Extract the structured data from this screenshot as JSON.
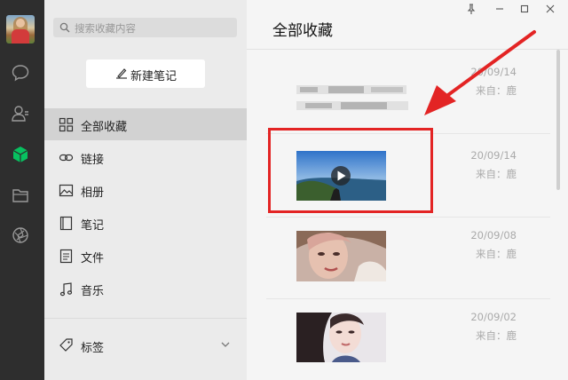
{
  "sidebar_rail": {
    "icons": [
      "avatar",
      "chat-icon",
      "contacts-icon",
      "favorites-cube-icon",
      "folder-icon",
      "moments-icon"
    ]
  },
  "search": {
    "placeholder": "搜索收藏内容"
  },
  "new_note": {
    "label": "新建笔记"
  },
  "nav": [
    {
      "label": "全部收藏",
      "icon": "grid-icon",
      "active": true
    },
    {
      "label": "链接",
      "icon": "link-icon"
    },
    {
      "label": "相册",
      "icon": "photo-icon"
    },
    {
      "label": "笔记",
      "icon": "note-icon"
    },
    {
      "label": "文件",
      "icon": "file-icon"
    },
    {
      "label": "音乐",
      "icon": "music-icon"
    }
  ],
  "tags": {
    "label": "标签"
  },
  "main": {
    "title": "全部收藏",
    "items": [
      {
        "date": "20/09/14",
        "source": "来自：鹿",
        "kind": "text-blurred"
      },
      {
        "date": "20/09/14",
        "source": "来自：鹿",
        "kind": "video"
      },
      {
        "date": "20/09/08",
        "source": "来自：鹿",
        "kind": "image"
      },
      {
        "date": "20/09/02",
        "source": "来自：鹿",
        "kind": "image"
      }
    ]
  },
  "colors": {
    "rail": "#2e2e2e",
    "accent_green": "#07c160",
    "highlight": "#e32424"
  }
}
